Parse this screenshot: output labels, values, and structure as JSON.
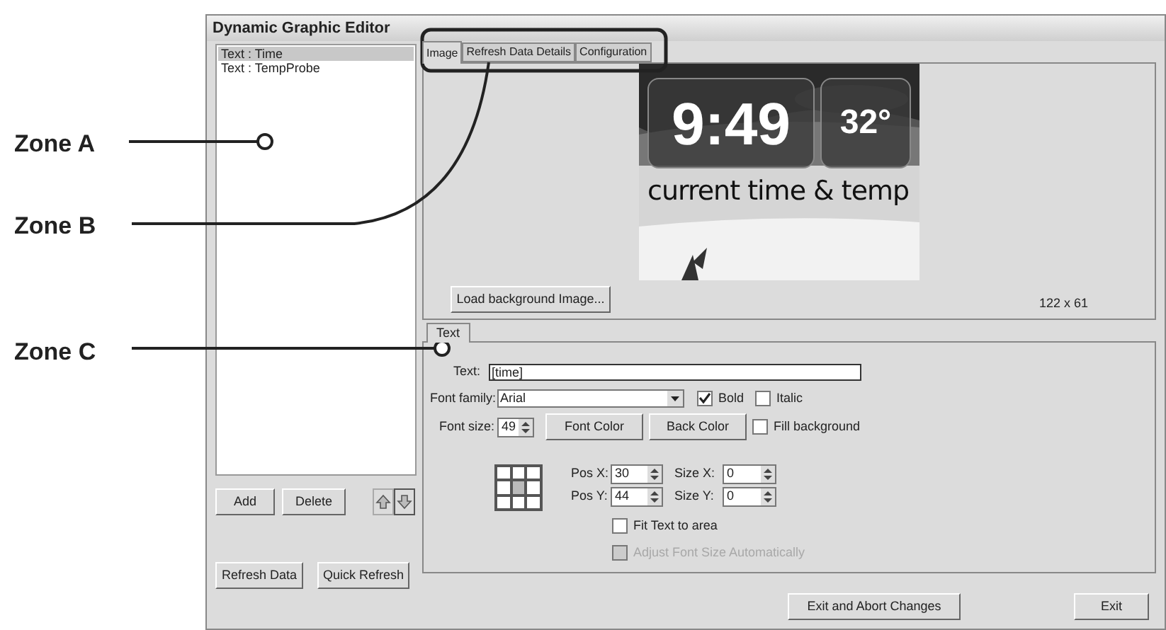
{
  "window": {
    "title": "Dynamic Graphic Editor"
  },
  "items": [
    {
      "label": "Text : Time",
      "selected": true
    },
    {
      "label": "Text : TempProbe",
      "selected": false
    }
  ],
  "list_buttons": [
    "Add",
    "Delete"
  ],
  "refresh_buttons": [
    "Refresh Data",
    "Quick Refresh"
  ],
  "tabs": [
    {
      "label": "Image",
      "selected": true
    },
    {
      "label": "Refresh Data Details",
      "selected": false
    },
    {
      "label": "Configuration",
      "selected": false
    }
  ],
  "preview": {
    "time": "9:49",
    "temp": "32°",
    "caption": "current time & temp"
  },
  "load_button": "Load background Image...",
  "image_size": "122 x 61",
  "editor_tabs": [
    {
      "label": "Text",
      "selected": true
    }
  ],
  "text_field": {
    "label": "Text:",
    "value": "[time]"
  },
  "font_family": {
    "label": "Font family:",
    "value": "Arial"
  },
  "style_checks": [
    {
      "label": "Bold",
      "checked": true
    },
    {
      "label": "Italic",
      "checked": false
    }
  ],
  "font_size": {
    "label": "Font size:",
    "value": "49"
  },
  "font_color_button": "Font Color",
  "back_color_button": "Back Color",
  "fill_background": {
    "label": "Fill background",
    "checked": false
  },
  "alignment_cells": [
    {
      "selected": false
    },
    {
      "selected": false
    },
    {
      "selected": false
    },
    {
      "selected": false
    },
    {
      "selected": true
    },
    {
      "selected": false
    },
    {
      "selected": false
    },
    {
      "selected": false
    },
    {
      "selected": false
    }
  ],
  "position": [
    {
      "label": "Pos X:",
      "value": "30"
    },
    {
      "label": "Pos Y:",
      "value": "44"
    }
  ],
  "size": [
    {
      "label": "Size X:",
      "value": "0"
    },
    {
      "label": "Size Y:",
      "value": "0"
    }
  ],
  "fit_checks": [
    {
      "label": "Fit Text to area",
      "checked": false,
      "disabled": false
    },
    {
      "label": "Adjust Font Size Automatically",
      "checked": false,
      "disabled": true
    }
  ],
  "footer_buttons": [
    "Exit and Abort Changes",
    "Exit"
  ],
  "annotations": [
    {
      "label": "Zone A"
    },
    {
      "label": "Zone B"
    },
    {
      "label": "Zone C"
    }
  ]
}
